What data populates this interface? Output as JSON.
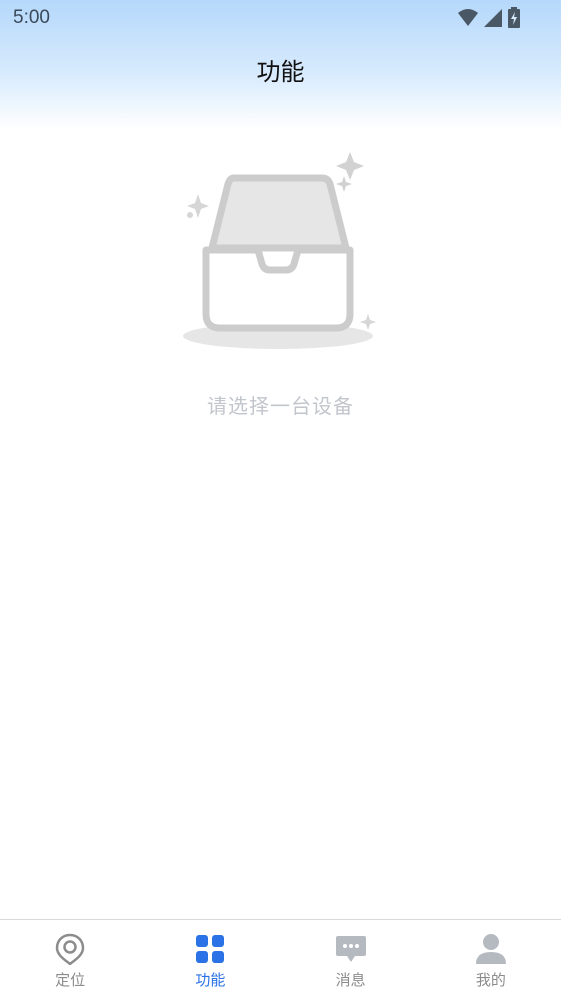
{
  "status_bar": {
    "time": "5:00",
    "icons": [
      "wifi-icon",
      "signal-icon",
      "battery-charging-icon"
    ]
  },
  "header": {
    "title": "功能"
  },
  "empty_state": {
    "illustration": "empty-inbox-icon",
    "message": "请选择一台设备"
  },
  "tab_bar": {
    "active_index": 1,
    "active_color": "#2a72e6",
    "inactive_color": "#8c8c8c",
    "items": [
      {
        "label": "定位",
        "icon": "location-pin-icon"
      },
      {
        "label": "功能",
        "icon": "grid-icon"
      },
      {
        "label": "消息",
        "icon": "chat-bubble-icon"
      },
      {
        "label": "我的",
        "icon": "user-icon"
      }
    ]
  }
}
